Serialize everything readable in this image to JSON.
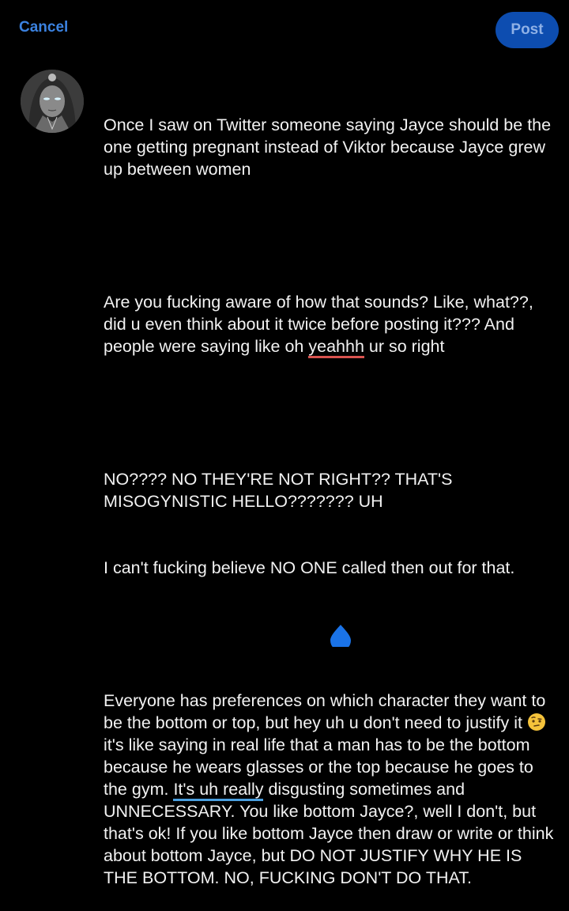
{
  "topbar": {
    "cancel_label": "Cancel",
    "post_label": "Post"
  },
  "colors": {
    "background": "#000000",
    "accent": "#3b82e0",
    "post_button_bg": "#0d4db0",
    "spellcheck_red": "#d9534f",
    "link_underline_blue": "#4a9fe0"
  },
  "avatar": {
    "icon": "avatar-icon"
  },
  "composer": {
    "p1": "Once I saw on Twitter someone saying Jayce should be the one getting pregnant instead of Viktor because Jayce grew up between women",
    "p2_a": "Are you fucking aware of how that sounds? Like, what??, did u even think about it twice before posting it??? And people were saying like oh ",
    "p2_underlined": "yeahhh",
    "p2_b": " ur so right",
    "p3_line1": "NO???? NO THEY'RE NOT RIGHT?? THAT'S MISOGYNISTIC HELLO??????? UH",
    "p3_line2": "I can't fucking believe NO ONE called then out for that.",
    "p4_a": "Everyone has preferences on which character they want to be the bottom or top, but hey uh u don't need to justify it ",
    "p4_emoji": "raised-eyebrow-emoji",
    "p4_b": " it's like saying in real life that a man has to be the bottom because he wears glasses or the top because he goes to the gym. ",
    "p4_underlined": "It's uh really",
    "p4_c": " disgusting sometimes and UNNECESSARY. You like bottom Jayce?, well I don't, but that's ok! If you like bottom Jayce then draw or write or think about bottom Jayce, but DO NOT JUSTIFY WHY HE IS THE BOTTOM. NO, FUCKING DON'T DO THAT."
  }
}
